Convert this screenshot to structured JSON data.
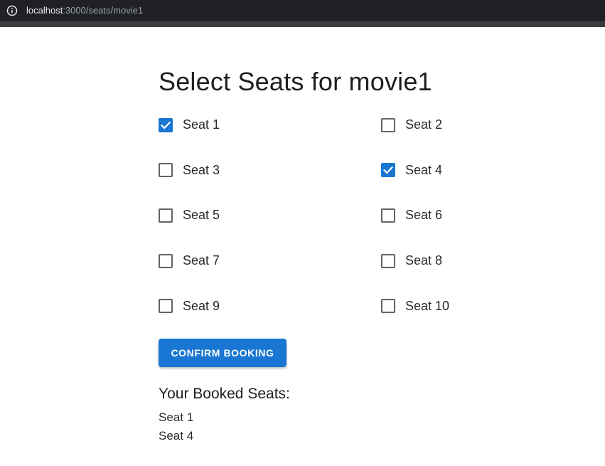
{
  "browser": {
    "url_host": "localhost",
    "url_path": ":3000/seats/movie1"
  },
  "page": {
    "title": "Select Seats for movie1"
  },
  "seats": [
    {
      "label": "Seat 1",
      "checked": true
    },
    {
      "label": "Seat 2",
      "checked": false
    },
    {
      "label": "Seat 3",
      "checked": false
    },
    {
      "label": "Seat 4",
      "checked": true
    },
    {
      "label": "Seat 5",
      "checked": false
    },
    {
      "label": "Seat 6",
      "checked": false
    },
    {
      "label": "Seat 7",
      "checked": false
    },
    {
      "label": "Seat 8",
      "checked": false
    },
    {
      "label": "Seat 9",
      "checked": false
    },
    {
      "label": "Seat 10",
      "checked": false
    }
  ],
  "actions": {
    "confirm_label": "CONFIRM BOOKING"
  },
  "booked": {
    "title": "Your Booked Seats:",
    "items": [
      "Seat 1",
      "Seat 4"
    ]
  },
  "colors": {
    "accent": "#1976d2",
    "browser_bar": "#202124"
  }
}
